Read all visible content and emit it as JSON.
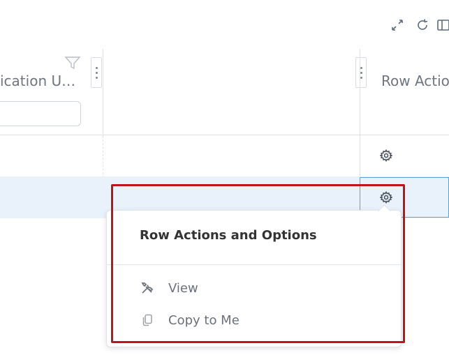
{
  "toolbar": {
    "icons": [
      "expand-icon",
      "refresh-icon",
      "columns-icon"
    ]
  },
  "columns": {
    "application_header": "ication U…",
    "row_actions_header": "Row Actio"
  },
  "filter": {
    "value": ""
  },
  "popup": {
    "title": "Row Actions and Options",
    "items": [
      {
        "label": "View",
        "icon": "tools-icon"
      },
      {
        "label": "Copy to Me",
        "icon": "copy-icon"
      }
    ]
  },
  "colors": {
    "highlight": "#c0141c",
    "selected_row": "#e9f2fb",
    "selected_border": "#5aa0db"
  }
}
